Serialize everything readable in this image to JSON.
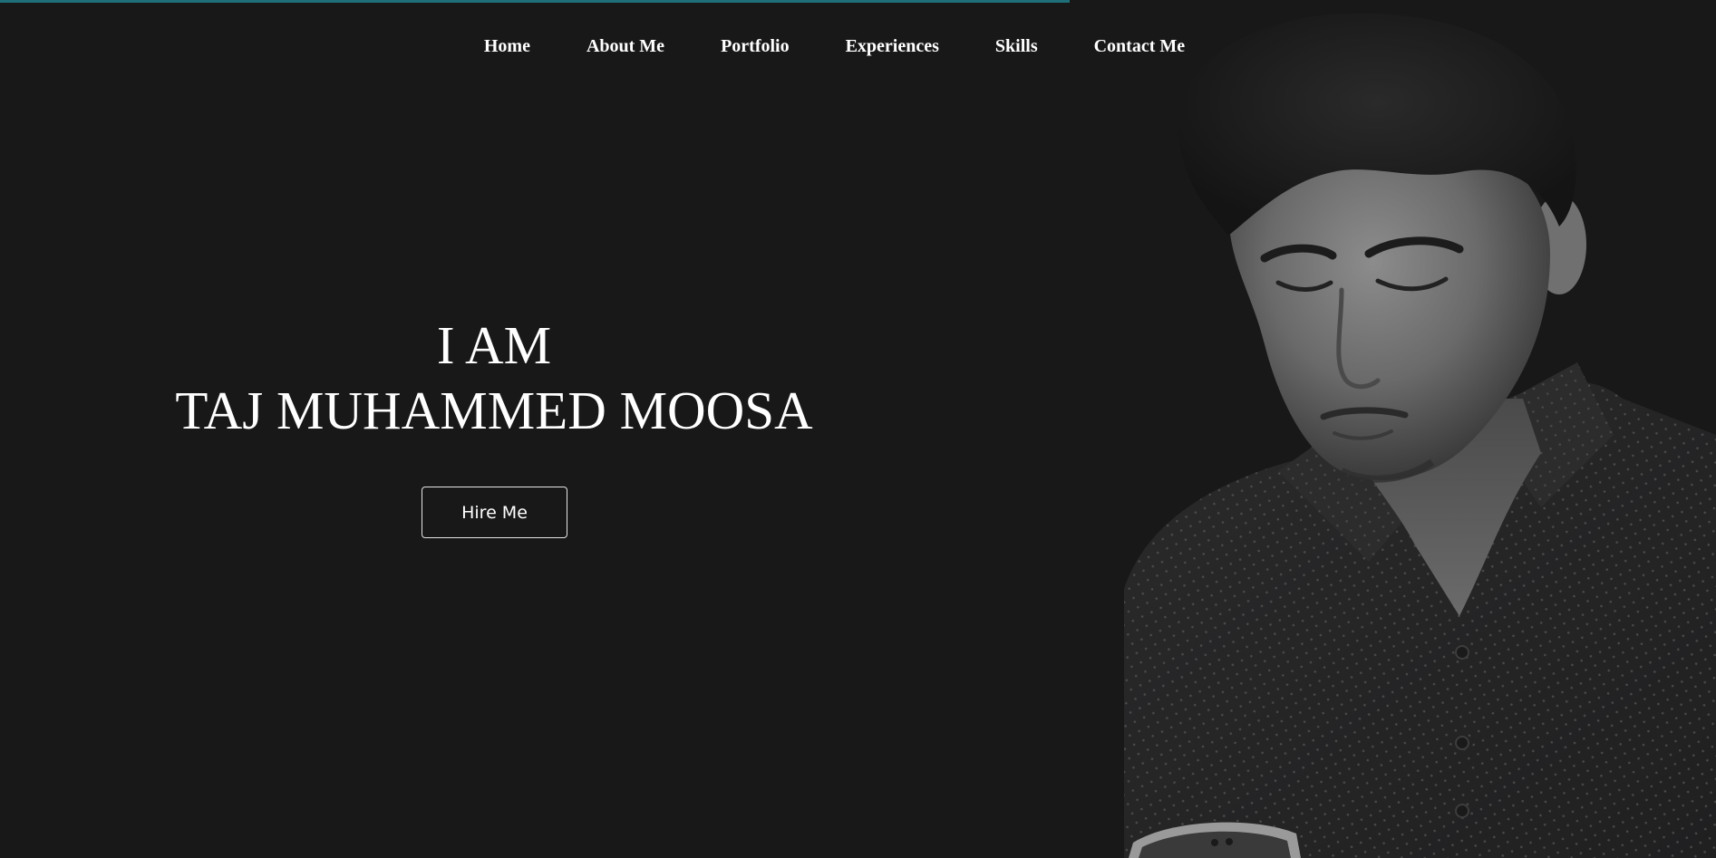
{
  "nav": {
    "items": [
      {
        "label": "Home"
      },
      {
        "label": "About Me"
      },
      {
        "label": "Portfolio"
      },
      {
        "label": "Experiences"
      },
      {
        "label": "Skills"
      },
      {
        "label": "Contact Me"
      }
    ]
  },
  "hero": {
    "line1": "I AM",
    "line2": "TAJ MUHAMMED MOOSA",
    "cta_label": "Hire Me"
  },
  "colors": {
    "background": "#181819",
    "accent_bar": "#1f6f78",
    "text": "#ffffff"
  },
  "portrait": {
    "icon": "person-photo-icon"
  }
}
